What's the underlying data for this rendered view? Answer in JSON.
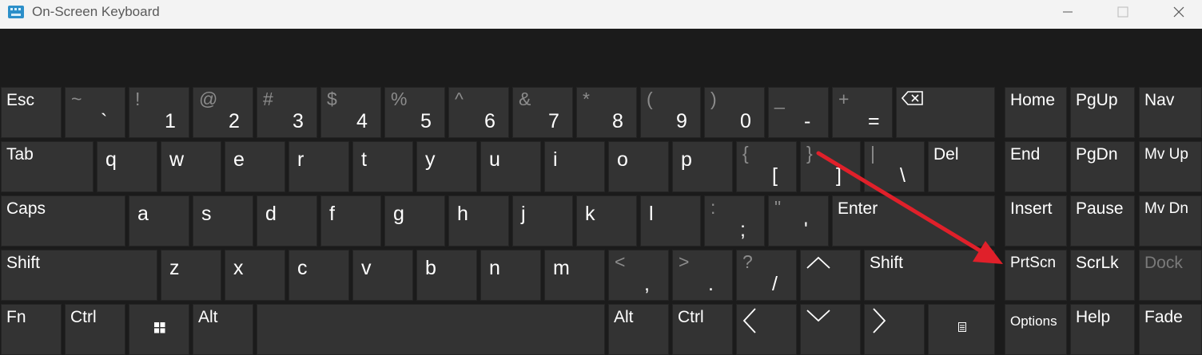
{
  "window": {
    "title": "On-Screen Keyboard",
    "controls": {
      "minimize": "minimize",
      "maximize": "maximize",
      "close": "close"
    }
  },
  "theme": {
    "titlebar_bg": "#f3f3f3",
    "keyboard_bg": "#1b1b1b",
    "key_bg": "#333333",
    "key_text": "#ffffff",
    "key_secondary_text": "#8c8c8c",
    "disabled_text": "#7a7a7a",
    "annotation_arrow": "#e0202a"
  },
  "keys": {
    "esc": "Esc",
    "backtick": {
      "shift": "~",
      "base": "`"
    },
    "d1": {
      "shift": "!",
      "base": "1"
    },
    "d2": {
      "shift": "@",
      "base": "2"
    },
    "d3": {
      "shift": "#",
      "base": "3"
    },
    "d4": {
      "shift": "$",
      "base": "4"
    },
    "d5": {
      "shift": "%",
      "base": "5"
    },
    "d6": {
      "shift": "^",
      "base": "6"
    },
    "d7": {
      "shift": "&",
      "base": "7"
    },
    "d8": {
      "shift": "*",
      "base": "8"
    },
    "d9": {
      "shift": "(",
      "base": "9"
    },
    "d0": {
      "shift": ")",
      "base": "0"
    },
    "minus": {
      "shift": "_",
      "base": "-"
    },
    "equals": {
      "shift": "+",
      "base": "="
    },
    "tab": "Tab",
    "q": "q",
    "w": "w",
    "e": "e",
    "r": "r",
    "t": "t",
    "y": "y",
    "u": "u",
    "i": "i",
    "o": "o",
    "p": "p",
    "lbracket": {
      "shift": "{",
      "base": "["
    },
    "rbracket": {
      "shift": "}",
      "base": "]"
    },
    "backslash": {
      "shift": "|",
      "base": "\\"
    },
    "del": "Del",
    "caps": "Caps",
    "a": "a",
    "s": "s",
    "d": "d",
    "f": "f",
    "g": "g",
    "h": "h",
    "j": "j",
    "k": "k",
    "l": "l",
    "semicolon": {
      "shift": ":",
      "base": ";"
    },
    "quote": {
      "shift": "\"",
      "base": "'"
    },
    "enter": "Enter",
    "shift_left": "Shift",
    "z": "z",
    "x": "x",
    "c": "c",
    "v": "v",
    "b": "b",
    "n": "n",
    "m": "m",
    "comma": {
      "shift": "<",
      "base": ","
    },
    "period": {
      "shift": ">",
      "base": "."
    },
    "slash": {
      "shift": "?",
      "base": "/"
    },
    "shift_right": "Shift",
    "fn": "Fn",
    "ctrl_left": "Ctrl",
    "alt_left": "Alt",
    "alt_right": "Alt",
    "ctrl_right": "Ctrl",
    "home": "Home",
    "pgup": "PgUp",
    "nav": "Nav",
    "end": "End",
    "pgdn": "PgDn",
    "mvup": "Mv Up",
    "insert": "Insert",
    "pause": "Pause",
    "mvdn": "Mv Dn",
    "prtscn": "PrtScn",
    "scrlk": "ScrLk",
    "dock": "Dock",
    "options": "Options",
    "help": "Help",
    "fade": "Fade"
  },
  "icons": {
    "app": "keyboard-icon",
    "backspace": "backspace-icon",
    "windows": "windows-logo-icon",
    "up": "arrow-up-icon",
    "left": "arrow-left-icon",
    "down": "arrow-down-icon",
    "right": "arrow-right-icon",
    "menu": "context-menu-icon"
  }
}
